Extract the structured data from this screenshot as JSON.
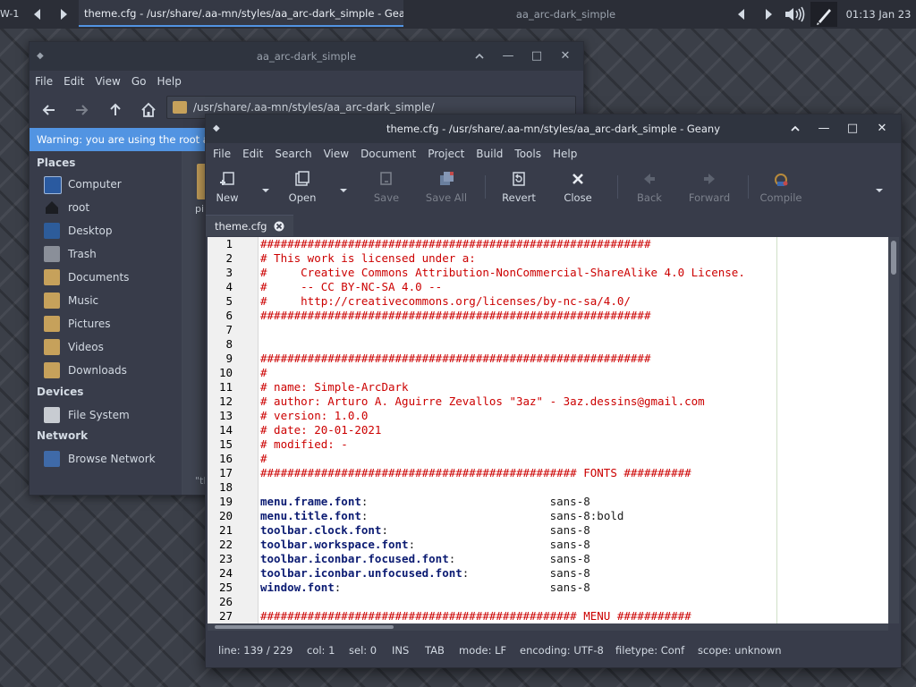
{
  "panel": {
    "workspace": "W-1",
    "active_task": "theme.cfg - /usr/share/.aa-mn/styles/aa_arc-dark_simple - Gean",
    "inactive_task": "aa_arc-dark_simple",
    "clock": "01:13  Jan 23"
  },
  "filemanager": {
    "title": "aa_arc-dark_simple",
    "menu": [
      "File",
      "Edit",
      "View",
      "Go",
      "Help"
    ],
    "path": "/usr/share/.aa-mn/styles/aa_arc-dark_simple/",
    "warning": "Warning: you are using the root acc",
    "sections": {
      "places": "Places",
      "devices": "Devices",
      "network": "Network"
    },
    "places": [
      {
        "label": "Computer",
        "icon": "computer-icon"
      },
      {
        "label": "root",
        "icon": "home-icon"
      },
      {
        "label": "Desktop",
        "icon": "desktop-icon"
      },
      {
        "label": "Trash",
        "icon": "trash-icon"
      },
      {
        "label": "Documents",
        "icon": "folder-documents-icon"
      },
      {
        "label": "Music",
        "icon": "folder-music-icon"
      },
      {
        "label": "Pictures",
        "icon": "folder-pictures-icon"
      },
      {
        "label": "Videos",
        "icon": "folder-videos-icon"
      },
      {
        "label": "Downloads",
        "icon": "folder-downloads-icon"
      }
    ],
    "devices": [
      {
        "label": "File System",
        "icon": "drive-icon"
      }
    ],
    "network": [
      {
        "label": "Browse Network",
        "icon": "network-icon"
      }
    ],
    "content_item": "pi",
    "status": "\"tl"
  },
  "geany": {
    "title": "theme.cfg - /usr/share/.aa-mn/styles/aa_arc-dark_simple - Geany",
    "menu": [
      "File",
      "Edit",
      "Search",
      "View",
      "Document",
      "Project",
      "Build",
      "Tools",
      "Help"
    ],
    "toolbar": {
      "new": "New",
      "open": "Open",
      "save": "Save",
      "save_all": "Save All",
      "revert": "Revert",
      "close": "Close",
      "back": "Back",
      "forward": "Forward",
      "compile": "Compile"
    },
    "tab": "theme.cfg",
    "lines": [
      {
        "n": "1",
        "parts": [
          {
            "t": "##########################################################",
            "c": "c"
          }
        ]
      },
      {
        "n": "2",
        "parts": [
          {
            "t": "# This work is licensed under a:",
            "c": "c"
          }
        ]
      },
      {
        "n": "3",
        "parts": [
          {
            "t": "#     Creative Commons Attribution-NonCommercial-ShareAlike 4.0 License.",
            "c": "c"
          }
        ]
      },
      {
        "n": "4",
        "parts": [
          {
            "t": "#     -- CC BY-NC-SA 4.0 --",
            "c": "c"
          }
        ]
      },
      {
        "n": "5",
        "parts": [
          {
            "t": "#     http://creativecommons.org/licenses/by-nc-sa/4.0/",
            "c": "c"
          }
        ]
      },
      {
        "n": "6",
        "parts": [
          {
            "t": "##########################################################",
            "c": "c"
          }
        ]
      },
      {
        "n": "7",
        "parts": []
      },
      {
        "n": "8",
        "parts": []
      },
      {
        "n": "9",
        "parts": [
          {
            "t": "##########################################################",
            "c": "c"
          }
        ]
      },
      {
        "n": "10",
        "parts": [
          {
            "t": "#",
            "c": "c"
          }
        ]
      },
      {
        "n": "11",
        "parts": [
          {
            "t": "# name: Simple-ArcDark",
            "c": "c"
          }
        ]
      },
      {
        "n": "12",
        "parts": [
          {
            "t": "# author: Arturo A. Aguirre Zevallos \"3az\" - 3az.dessins@gmail.com",
            "c": "c"
          }
        ]
      },
      {
        "n": "13",
        "parts": [
          {
            "t": "# version: 1.0.0",
            "c": "c"
          }
        ]
      },
      {
        "n": "14",
        "parts": [
          {
            "t": "# date: 20-01-2021",
            "c": "c"
          }
        ]
      },
      {
        "n": "15",
        "parts": [
          {
            "t": "# modified: -",
            "c": "c"
          }
        ]
      },
      {
        "n": "16",
        "parts": [
          {
            "t": "#",
            "c": "c"
          }
        ]
      },
      {
        "n": "17",
        "parts": [
          {
            "t": "############################################### FONTS ##########",
            "c": "c"
          }
        ]
      },
      {
        "n": "18",
        "parts": []
      },
      {
        "n": "19",
        "parts": [
          {
            "t": "menu.frame.font",
            "c": "k"
          },
          {
            "t": ":                           sans-8",
            "c": "v"
          }
        ]
      },
      {
        "n": "20",
        "parts": [
          {
            "t": "menu.title.font",
            "c": "k"
          },
          {
            "t": ":                           sans-8:bold",
            "c": "v"
          }
        ]
      },
      {
        "n": "21",
        "parts": [
          {
            "t": "toolbar.clock.font",
            "c": "k"
          },
          {
            "t": ":                        sans-8",
            "c": "v"
          }
        ]
      },
      {
        "n": "22",
        "parts": [
          {
            "t": "toolbar.workspace.font",
            "c": "k"
          },
          {
            "t": ":                    sans-8",
            "c": "v"
          }
        ]
      },
      {
        "n": "23",
        "parts": [
          {
            "t": "toolbar.iconbar.focused.font",
            "c": "k"
          },
          {
            "t": ":              sans-8",
            "c": "v"
          }
        ]
      },
      {
        "n": "24",
        "parts": [
          {
            "t": "toolbar.iconbar.unfocused.font",
            "c": "k"
          },
          {
            "t": ":            sans-8",
            "c": "v"
          }
        ]
      },
      {
        "n": "25",
        "parts": [
          {
            "t": "window.font",
            "c": "k"
          },
          {
            "t": ":                               sans-8",
            "c": "v"
          }
        ]
      },
      {
        "n": "26",
        "parts": []
      },
      {
        "n": "27",
        "parts": [
          {
            "t": "############################################### MENU ###########",
            "c": "c"
          }
        ]
      }
    ],
    "status": {
      "line": "line: 139 / 229",
      "col": "col: 1",
      "sel": "sel: 0",
      "ins": "INS",
      "tab": "TAB",
      "mode": "mode: LF",
      "encoding": "encoding: UTF-8",
      "filetype": "filetype: Conf",
      "scope": "scope: unknown"
    }
  },
  "colors": {
    "accent": "#5294e2",
    "comment": "#cc0000",
    "keyword": "#0b1b72",
    "folder": "#c6a15b"
  }
}
